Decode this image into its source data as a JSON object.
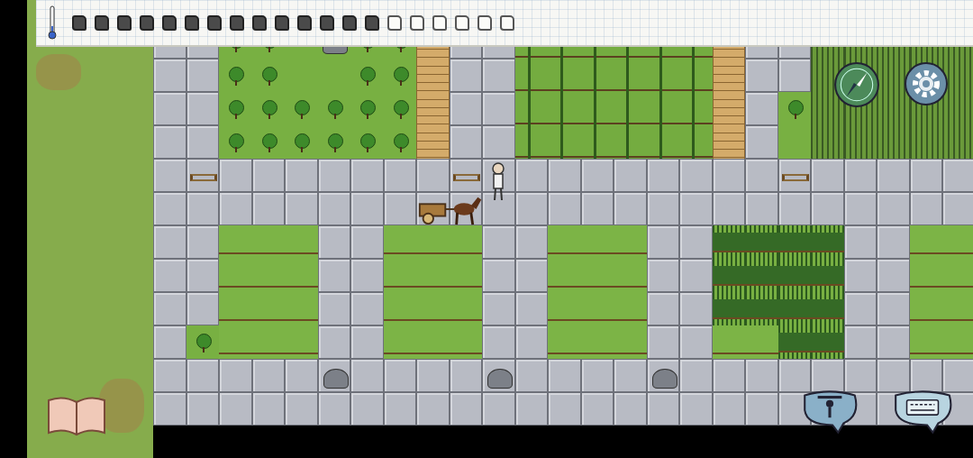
{
  "hud": {
    "temperature": {
      "level": 0.3
    },
    "food_pips": [
      {
        "filled": true
      },
      {
        "filled": true
      },
      {
        "filled": true
      },
      {
        "filled": true
      },
      {
        "filled": true
      },
      {
        "filled": true
      },
      {
        "filled": true
      },
      {
        "filled": true
      },
      {
        "filled": true
      },
      {
        "filled": true
      },
      {
        "filled": true
      },
      {
        "filled": true
      },
      {
        "filled": true
      },
      {
        "filled": true
      },
      {
        "filled": false
      },
      {
        "filled": false
      },
      {
        "filled": false
      },
      {
        "filled": false
      },
      {
        "filled": false
      },
      {
        "filled": false
      }
    ]
  },
  "map": {
    "rows": [
      "SSBBBBBBKSSCCCCCCKSSWWWWW",
      "SSBBGOBBKSSCCCCCCKSSWWWWW",
      "SSBBGGBBKSSCCCCCCKSSWWWWW",
      "SSBBBBBBKSSCCCCCCKSBWWWWW",
      "SSBBBBBBKSSCCCCCCKSGWWWWW",
      "SFSSSSSSSFSSSSSSSSSFSSSSS",
      "SSSSSSSSSSSSSSSSSSSSSSSSS",
      "SSTTTSSTTTSSTTTSSRRRRSSTT",
      "SSTTTSSTTTSSTTTSSRRRRSSTT",
      "SSTTTSSTTTSSTTTSSRRRRSSTT",
      "SBTTTSSTTTSSTTTSSTTRRSSTT",
      "SSSSSPSSSSPSSSSPSSSSSSSSS",
      "SSSSSSSSSSSSSSSSSSSSSSSSS"
    ]
  }
}
